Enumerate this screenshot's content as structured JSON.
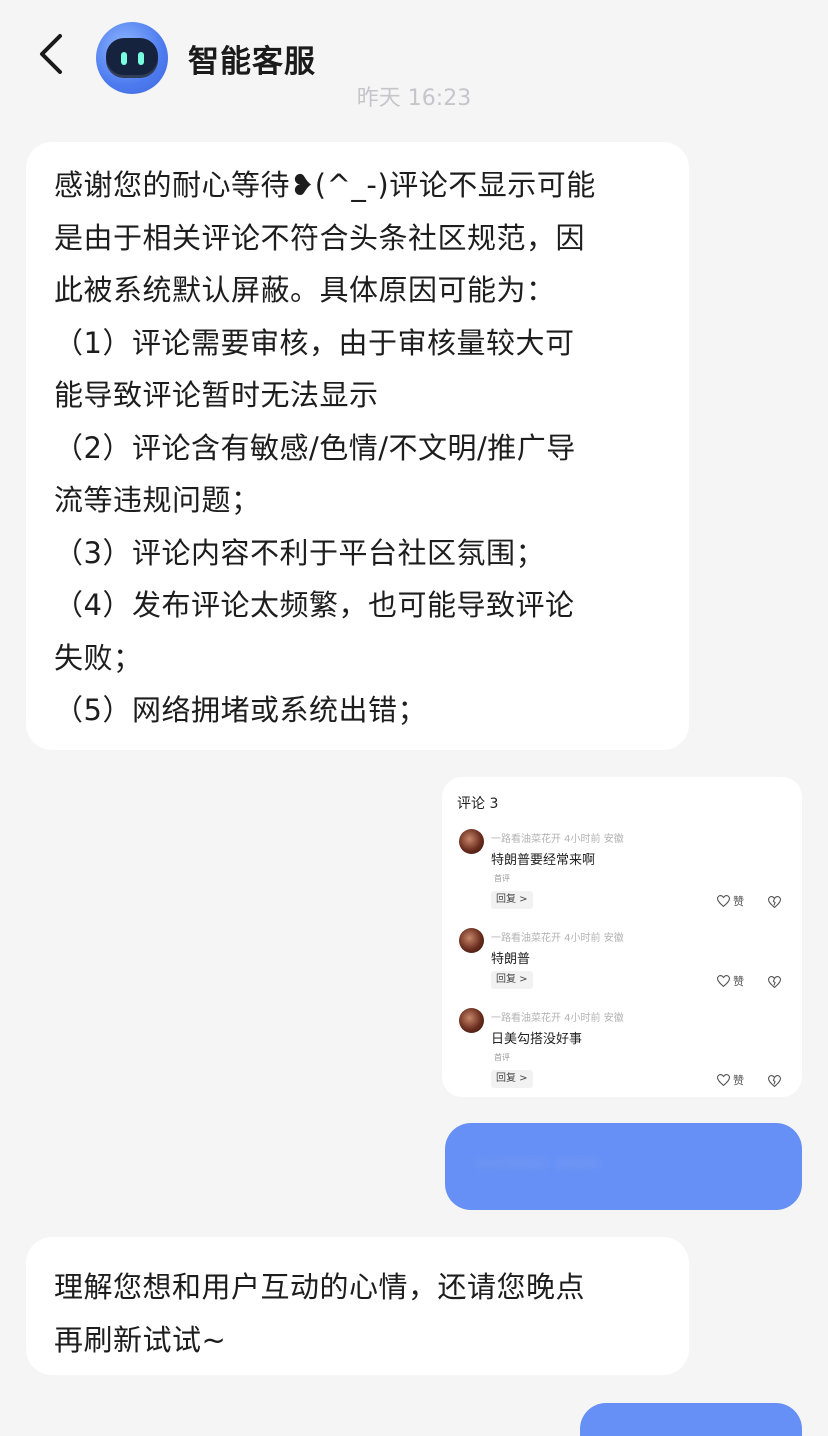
{
  "header": {
    "title": "智能客服"
  },
  "timestamp": "昨天 16:23",
  "messages": {
    "agent_reply_1": "感谢您的耐心等待❥(^_-)评论不显示可能\n是由于相关评论不符合头条社区规范，因\n此被系统默认屏蔽。具体原因可能为：\n（1）评论需要审核，由于审核量较大可\n能导致评论暂时无法显示\n（2）评论含有敏感/色情/不文明/推广导\n流等违规问题；\n（3）评论内容不利于平台社区氛围；\n（4）发布评论太频繁，也可能导致评论\n失败；\n（5）网络拥堵或系统出错；",
    "agent_reply_2": "理解您想和用户互动的心情，还请您晚点\n再刷新试试~"
  },
  "screenshot": {
    "title": "评论 3",
    "comments": [
      {
        "meta": "一路看油菜花开  4小时前  安徽",
        "text": "特朗普要经常来啊",
        "tag": "首评",
        "reply": "回复 >",
        "like": "赞"
      },
      {
        "meta": "一路看油菜花开  4小时前  安徽",
        "text": "特朗普",
        "tag": "",
        "reply": "回复 >",
        "like": "赞"
      },
      {
        "meta": "一路看油菜花开  4小时前  安徽",
        "text": "日美勾搭没好事",
        "tag": "首评",
        "reply": "回复 >",
        "like": "赞"
      }
    ]
  },
  "user_message_blurred": "········ ·····",
  "colors": {
    "background": "#f5f5f6",
    "agent_bubble": "#ffffff",
    "user_bubble": "#6690f5",
    "avatar_blue": "#4d7bef"
  },
  "icons": {
    "back": "chevron-left-icon",
    "avatar": "robot-avatar-icon",
    "like": "heart-icon",
    "dislike": "heart-broken-icon"
  }
}
